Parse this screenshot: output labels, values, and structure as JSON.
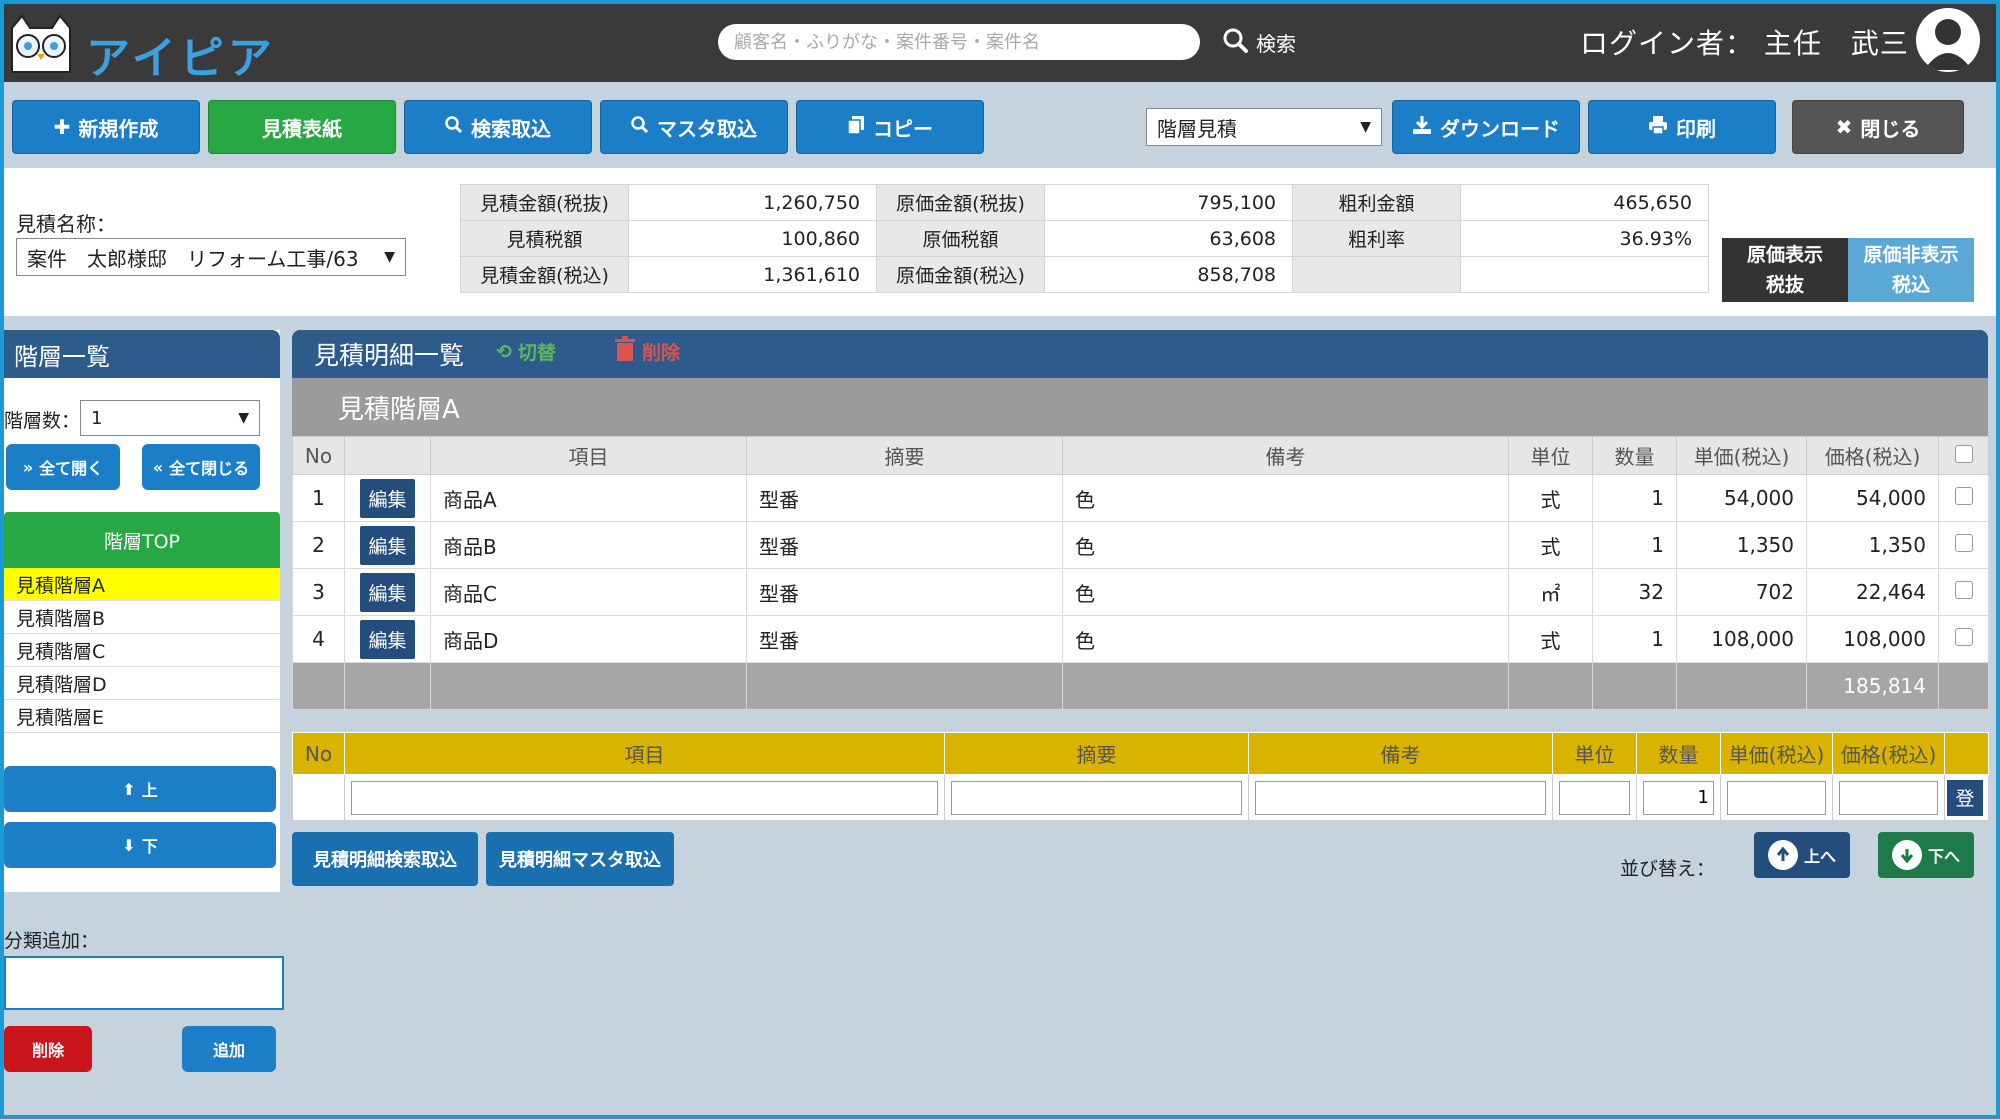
{
  "header": {
    "app_name": "アイピア",
    "search_placeholder": "顧客名・ふりがな・案件番号・案件名",
    "search_label": "検索",
    "login_text": "ログイン者： 主任　武三"
  },
  "toolbar": {
    "new_label": "新規作成",
    "cover_label": "見積表紙",
    "search_import_label": "検索取込",
    "master_import_label": "マスタ取込",
    "copy_label": "コピー",
    "format_select": "階層見積",
    "download_label": "ダウンロード",
    "print_label": "印刷",
    "close_label": "閉じる"
  },
  "summary": {
    "estimate_name_label": "見積名称：",
    "estimate_name_value": "案件　太郎様邸　リフォーム工事/63",
    "rows": [
      {
        "l1": "見積金額(税抜)",
        "v1": "1,260,750",
        "l2": "原価金額(税抜)",
        "v2": "795,100",
        "l3": "粗利金額",
        "v3": "465,650"
      },
      {
        "l1": "見積税額",
        "v1": "100,860",
        "l2": "原価税額",
        "v2": "63,608",
        "l3": "粗利率",
        "v3": "36.93%"
      },
      {
        "l1": "見積金額(税込)",
        "v1": "1,361,610",
        "l2": "原価金額(税込)",
        "v2": "858,708",
        "l3": "",
        "v3": ""
      }
    ],
    "cost_show_line1": "原価表示",
    "cost_show_line2": "税抜",
    "cost_hide_line1": "原価非表示",
    "cost_hide_line2": "税込"
  },
  "left": {
    "title": "階層一覧",
    "levels_label": "階層数：",
    "levels_value": "1",
    "expand_all": "全て開く",
    "collapse_all": "全て閉じる",
    "tree_top": "階層TOP",
    "tree_items": [
      "見積階層A",
      "見積階層B",
      "見積階層C",
      "見積階層D",
      "見積階層E"
    ],
    "up_label": "上",
    "down_label": "下",
    "category_add_label": "分類追加：",
    "delete_label": "削除",
    "add_label": "追加"
  },
  "main": {
    "title": "見積明細一覧",
    "switch_label": "切替",
    "delete_label": "削除",
    "group_title": "見積階層A",
    "columns": [
      "No",
      "",
      "項目",
      "摘要",
      "備考",
      "単位",
      "数量",
      "単価(税込)",
      "価格(税込)"
    ],
    "edit_label": "編集",
    "rows": [
      {
        "no": "1",
        "item": "商品A",
        "summary": "型番",
        "note": "色",
        "unit": "式",
        "qty": "1",
        "price": "54,000",
        "amount": "54,000"
      },
      {
        "no": "2",
        "item": "商品B",
        "summary": "型番",
        "note": "色",
        "unit": "式",
        "qty": "1",
        "price": "1,350",
        "amount": "1,350"
      },
      {
        "no": "3",
        "item": "商品C",
        "summary": "型番",
        "note": "色",
        "unit": "㎡",
        "qty": "32",
        "price": "702",
        "amount": "22,464"
      },
      {
        "no": "4",
        "item": "商品D",
        "summary": "型番",
        "note": "色",
        "unit": "式",
        "qty": "1",
        "price": "108,000",
        "amount": "108,000"
      }
    ],
    "total": "185,814",
    "entry_columns": [
      "No",
      "項目",
      "摘要",
      "備考",
      "単位",
      "数量",
      "単価(税込)",
      "価格(税込)"
    ],
    "entry_qty": "1",
    "register_label": "登",
    "detail_search_import": "見積明細検索取込",
    "detail_master_import": "見積明細マスタ取込",
    "sort_label": "並び替え：",
    "sort_up": "上へ",
    "sort_down": "下へ"
  },
  "colors": {
    "header_bg": "#3a3a3a",
    "brand_blue": "#1b7ec6",
    "green": "#28a745",
    "panel_navy": "#2d5c8c",
    "selected_yellow": "#ffff00",
    "entry_header_gold": "#d9b300",
    "delete_red": "#c9151b"
  }
}
